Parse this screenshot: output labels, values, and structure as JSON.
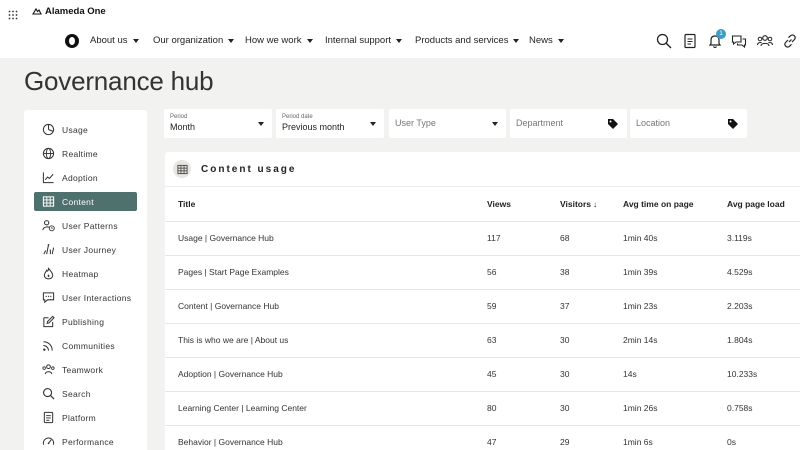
{
  "topbar": {
    "brand": "Alameda One"
  },
  "nav": {
    "items": [
      {
        "label": "About us"
      },
      {
        "label": "Our organization"
      },
      {
        "label": "How we work"
      },
      {
        "label": "Internal support"
      },
      {
        "label": "Products and services"
      },
      {
        "label": "News"
      }
    ],
    "notification_count": "1"
  },
  "page": {
    "title": "Governance hub"
  },
  "sidebar": {
    "items": [
      {
        "label": "Usage",
        "icon": "pie-chart-icon"
      },
      {
        "label": "Realtime",
        "icon": "globe-icon"
      },
      {
        "label": "Adoption",
        "icon": "line-chart-icon"
      },
      {
        "label": "Content",
        "icon": "table-icon",
        "active": true
      },
      {
        "label": "User Patterns",
        "icon": "user-clock-icon"
      },
      {
        "label": "User Journey",
        "icon": "footsteps-icon"
      },
      {
        "label": "Heatmap",
        "icon": "flame-icon"
      },
      {
        "label": "User Interactions",
        "icon": "chat-icon"
      },
      {
        "label": "Publishing",
        "icon": "edit-icon"
      },
      {
        "label": "Communities",
        "icon": "signal-icon"
      },
      {
        "label": "Teamwork",
        "icon": "team-icon"
      },
      {
        "label": "Search",
        "icon": "search-icon"
      },
      {
        "label": "Platform",
        "icon": "platform-icon"
      },
      {
        "label": "Performance",
        "icon": "gauge-icon"
      }
    ]
  },
  "filters": {
    "period": {
      "label": "Period",
      "value": "Month"
    },
    "period_date": {
      "label": "Period date",
      "value": "Previous month"
    },
    "user_type": {
      "placeholder": "User Type"
    },
    "department": {
      "placeholder": "Department"
    },
    "location": {
      "placeholder": "Location"
    }
  },
  "content_card": {
    "title": "Content usage",
    "columns": [
      "Title",
      "Views",
      "Visitors",
      "Avg time on page",
      "Avg page load"
    ],
    "sort_indicator": "↓",
    "rows": [
      {
        "title": "Usage | Governance Hub",
        "views": "117",
        "visitors": "68",
        "avg_time": "1min 40s",
        "avg_load": "3.119s"
      },
      {
        "title": "Pages | Start Page Examples",
        "views": "56",
        "visitors": "38",
        "avg_time": "1min 39s",
        "avg_load": "4.529s"
      },
      {
        "title": "Content | Governance Hub",
        "views": "59",
        "visitors": "37",
        "avg_time": "1min 23s",
        "avg_load": "2.203s"
      },
      {
        "title": "This is who we are | About us",
        "views": "63",
        "visitors": "30",
        "avg_time": "2min 14s",
        "avg_load": "1.804s"
      },
      {
        "title": "Adoption | Governance Hub",
        "views": "45",
        "visitors": "30",
        "avg_time": "14s",
        "avg_load": "10.233s"
      },
      {
        "title": "Learning Center | Learning Center",
        "views": "80",
        "visitors": "30",
        "avg_time": "1min 26s",
        "avg_load": "0.758s"
      },
      {
        "title": "Behavior | Governance Hub",
        "views": "47",
        "visitors": "29",
        "avg_time": "1min 6s",
        "avg_load": "0s"
      }
    ]
  }
}
